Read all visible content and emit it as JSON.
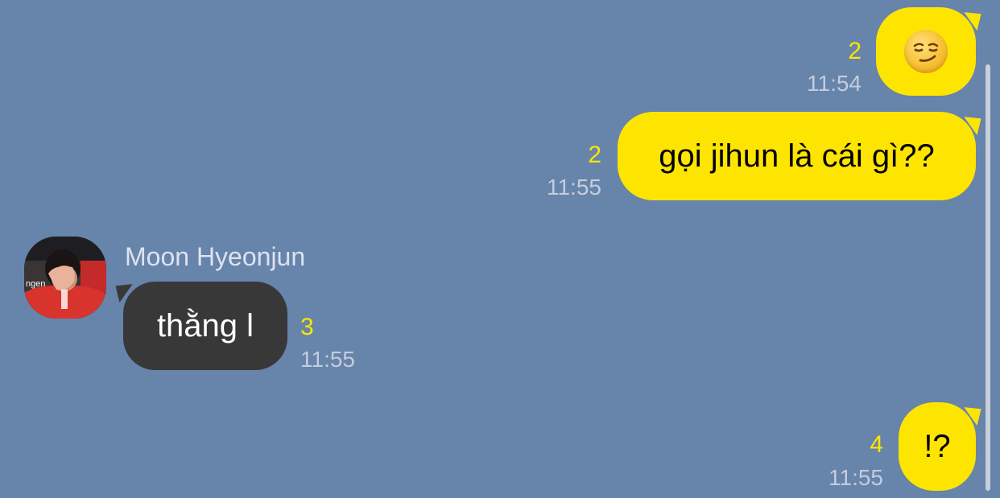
{
  "chat": {
    "messages": [
      {
        "direction": "sent",
        "type": "emoji",
        "emoji_name": "smirking-face",
        "unread_count": "2",
        "time": "11:54"
      },
      {
        "direction": "sent",
        "type": "text",
        "text": "gọi jihun là cái gì??",
        "unread_count": "2",
        "time": "11:55"
      },
      {
        "direction": "received",
        "type": "text",
        "sender": "Moon Hyeonjun",
        "text": "thằng l",
        "unread_count": "3",
        "time": "11:55"
      },
      {
        "direction": "sent",
        "type": "text",
        "text": "!?",
        "unread_count": "4",
        "time": "11:55"
      }
    ]
  },
  "colors": {
    "background": "#6784ab",
    "sent_bubble": "#fee500",
    "received_bubble": "#383838",
    "unread_count": "#fee500",
    "timestamp": "#c3cddc"
  },
  "icons": {
    "avatar": "profile-photo",
    "emoji": "smirking-face-emoji"
  }
}
